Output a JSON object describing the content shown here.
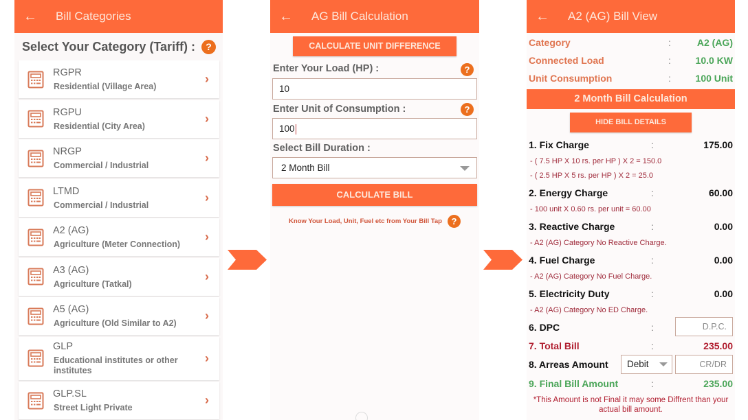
{
  "colors": {
    "accent": "#fe6a3a",
    "help": "#ec6f1e",
    "green": "#4aa558",
    "red": "#b01c2e"
  },
  "panel1": {
    "title": "Bill Categories",
    "heading": "Select Your Category (Tariff) :",
    "help_icon": "?",
    "categories": [
      {
        "code": "RGPR",
        "desc": "Residential (Village Area)"
      },
      {
        "code": "RGPU",
        "desc": "Residential (City Area)"
      },
      {
        "code": "NRGP",
        "desc": "Commercial / Industrial"
      },
      {
        "code": "LTMD",
        "desc": "Commercial / Industrial"
      },
      {
        "code": "A2 (AG)",
        "desc": "Agriculture (Meter Connection)"
      },
      {
        "code": "A3 (AG)",
        "desc": "Agriculture (Tatkal)"
      },
      {
        "code": "A5 (AG)",
        "desc": "Agriculture (Old Similar to A2)"
      },
      {
        "code": "GLP",
        "desc": "Educational institutes or other institutes"
      },
      {
        "code": "GLP.SL",
        "desc": "Street Light Private"
      }
    ],
    "chevron": "›"
  },
  "panel2": {
    "title": "AG Bill Calculation",
    "unit_diff_button": "CALCULATE UNIT DIFFERENCE",
    "load_label": "Enter Your Load (HP) :",
    "load_value": "10",
    "unit_label": "Enter Unit of Consumption :",
    "unit_value": "100",
    "duration_label": "Select Bill Duration :",
    "duration_value": "2 Month Bill",
    "calc_button": "CALCULATE BILL",
    "know_text": "Know Your Load, Unit, Fuel etc from Your Bill Tap",
    "help_icon": "?"
  },
  "panel3": {
    "title": "A2 (AG) Bill View",
    "info": [
      {
        "label": "Category",
        "colon": ":",
        "value": "A2 (AG)"
      },
      {
        "label": "Connected Load",
        "colon": ":",
        "value": "10.0 KW"
      },
      {
        "label": "Unit Consumption",
        "colon": ":",
        "value": "100 Unit"
      }
    ],
    "section_title": "2 Month Bill Calculation",
    "hide_button": "HIDE BILL DETAILS",
    "charges": {
      "fix": {
        "label": "1. Fix Charge",
        "value": "175.00",
        "notes": [
          "- ( 7.5 HP X 10 rs. per HP ) X 2 = 150.0",
          "- ( 2.5 HP X 5 rs. per HP ) X 2 = 25.0"
        ]
      },
      "energy": {
        "label": "2. Energy Charge",
        "value": "60.00",
        "notes": [
          "- 100  unit X 0.60  rs. per unit = 60.00"
        ]
      },
      "reactive": {
        "label": "3. Reactive Charge",
        "value": "0.00",
        "notes": [
          "- A2 (AG) Category No Reactive Charge."
        ]
      },
      "fuel": {
        "label": "4. Fuel Charge",
        "value": "0.00",
        "notes": [
          "- A2 (AG) Category No Fuel Charge."
        ]
      },
      "duty": {
        "label": "5. Electricity Duty",
        "value": "0.00",
        "notes": [
          "- A2 (AG) Category No ED Charge."
        ]
      },
      "dpc": {
        "label": "6. DPC",
        "placeholder": "D.P.C."
      },
      "total": {
        "label": "7. Total Bill",
        "value": "235.00"
      },
      "arrears": {
        "label": "8. Arreas Amount",
        "select_value": "Debit",
        "placeholder": "CR/DR"
      },
      "final": {
        "label": "9. Final Bill Amount",
        "value": "235.00"
      }
    },
    "colon": ":",
    "disclaimer": "*This Amount is not Final it may some Diffrent than your actual bill amount."
  }
}
